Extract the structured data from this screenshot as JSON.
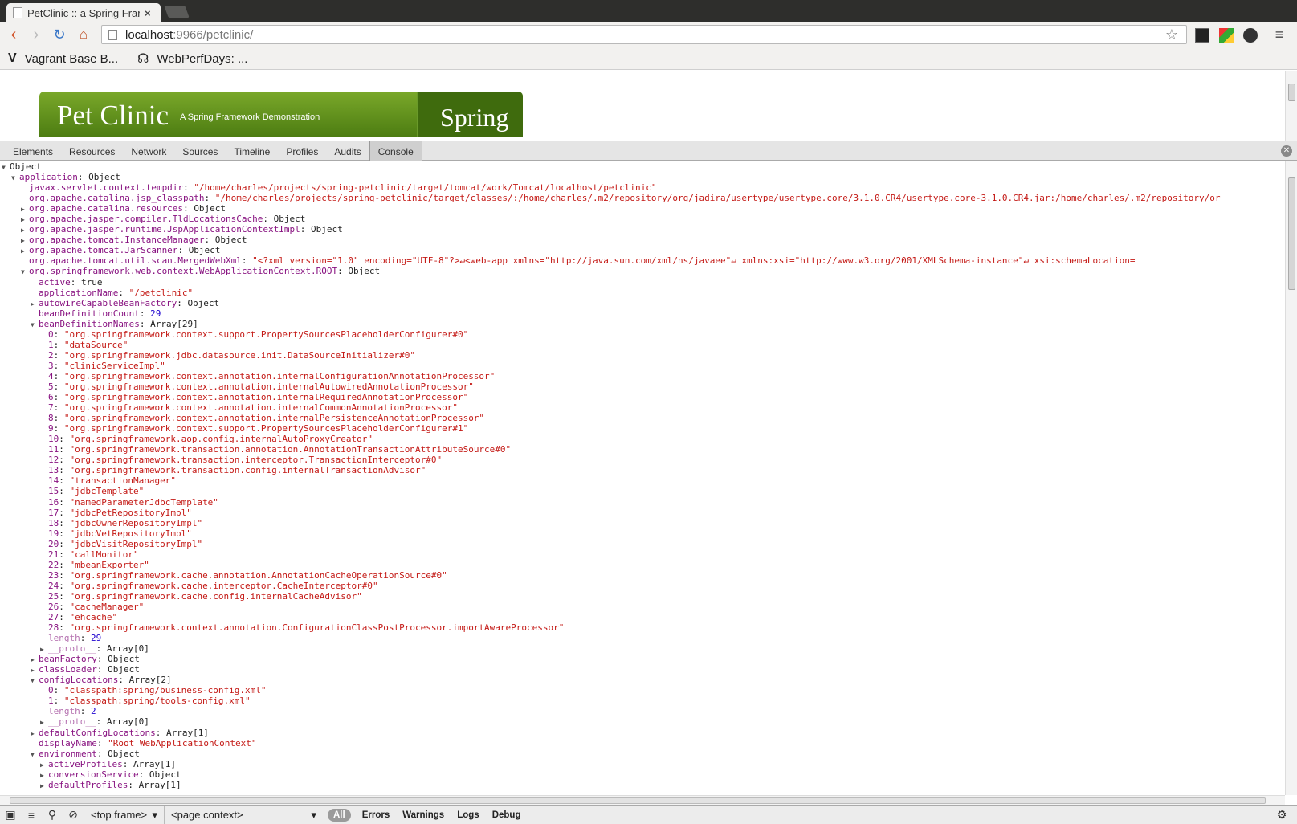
{
  "browser": {
    "tab_title": "PetClinic :: a Spring Frame",
    "tab_close": "×",
    "url_host": "localhost",
    "url_path": ":9966/petclinic/",
    "bookmarks": [
      {
        "icon": "V",
        "label": "Vagrant Base B..."
      },
      {
        "icon": "☊",
        "label": "WebPerfDays: ..."
      }
    ]
  },
  "page": {
    "banner_title": "Pet Clinic",
    "banner_subtitle": "A Spring Framework Demonstration",
    "banner_logo": "Spring"
  },
  "devtools": {
    "tabs": [
      "Elements",
      "Resources",
      "Network",
      "Sources",
      "Timeline",
      "Profiles",
      "Audits",
      "Console"
    ],
    "active_tab": "Console",
    "status": {
      "frame": "<top frame>",
      "context": "<page context>",
      "filters": [
        "All",
        "Errors",
        "Warnings",
        "Logs",
        "Debug"
      ]
    }
  },
  "console": {
    "lines": [
      {
        "indent": 0,
        "tri": "▼",
        "key": "Object",
        "keyclass": "v",
        "sep": "",
        "val": "",
        "valclass": "v"
      },
      {
        "indent": 1,
        "tri": "▼",
        "key": "application",
        "keyclass": "k",
        "sep": ": ",
        "val": "Object",
        "valclass": "v"
      },
      {
        "indent": 2,
        "tri": "",
        "key": "javax.servlet.context.tempdir",
        "keyclass": "k",
        "sep": ": ",
        "val": "\"/home/charles/projects/spring-petclinic/target/tomcat/work/Tomcat/localhost/petclinic\"",
        "valclass": "s"
      },
      {
        "indent": 2,
        "tri": "",
        "key": "org.apache.catalina.jsp_classpath",
        "keyclass": "k",
        "sep": ": ",
        "val": "\"/home/charles/projects/spring-petclinic/target/classes/:/home/charles/.m2/repository/org/jadira/usertype/usertype.core/3.1.0.CR4/usertype.core-3.1.0.CR4.jar:/home/charles/.m2/repository/or",
        "valclass": "s"
      },
      {
        "indent": 2,
        "tri": "▶",
        "key": "org.apache.catalina.resources",
        "keyclass": "k",
        "sep": ": ",
        "val": "Object",
        "valclass": "v"
      },
      {
        "indent": 2,
        "tri": "▶",
        "key": "org.apache.jasper.compiler.TldLocationsCache",
        "keyclass": "k",
        "sep": ": ",
        "val": "Object",
        "valclass": "v"
      },
      {
        "indent": 2,
        "tri": "▶",
        "key": "org.apache.jasper.runtime.JspApplicationContextImpl",
        "keyclass": "k",
        "sep": ": ",
        "val": "Object",
        "valclass": "v"
      },
      {
        "indent": 2,
        "tri": "▶",
        "key": "org.apache.tomcat.InstanceManager",
        "keyclass": "k",
        "sep": ": ",
        "val": "Object",
        "valclass": "v"
      },
      {
        "indent": 2,
        "tri": "▶",
        "key": "org.apache.tomcat.JarScanner",
        "keyclass": "k",
        "sep": ": ",
        "val": "Object",
        "valclass": "v"
      },
      {
        "indent": 2,
        "tri": "",
        "key": "org.apache.tomcat.util.scan.MergedWebXml",
        "keyclass": "k",
        "sep": ": ",
        "val": "\"<?xml version=\"1.0\" encoding=\"UTF-8\"?>↵<web-app xmlns=\"http://java.sun.com/xml/ns/javaee\"↵         xmlns:xsi=\"http://www.w3.org/2001/XMLSchema-instance\"↵         xsi:schemaLocation=",
        "valclass": "s"
      },
      {
        "indent": 2,
        "tri": "▼",
        "key": "org.springframework.web.context.WebApplicationContext.ROOT",
        "keyclass": "k",
        "sep": ": ",
        "val": "Object",
        "valclass": "v"
      },
      {
        "indent": 3,
        "tri": "",
        "key": "active",
        "keyclass": "k",
        "sep": ": ",
        "val": "true",
        "valclass": "v"
      },
      {
        "indent": 3,
        "tri": "",
        "key": "applicationName",
        "keyclass": "k",
        "sep": ": ",
        "val": "\"/petclinic\"",
        "valclass": "s"
      },
      {
        "indent": 3,
        "tri": "▶",
        "key": "autowireCapableBeanFactory",
        "keyclass": "k",
        "sep": ": ",
        "val": "Object",
        "valclass": "v"
      },
      {
        "indent": 3,
        "tri": "",
        "key": "beanDefinitionCount",
        "keyclass": "k",
        "sep": ": ",
        "val": "29",
        "valclass": "n"
      },
      {
        "indent": 3,
        "tri": "▼",
        "key": "beanDefinitionNames",
        "keyclass": "k",
        "sep": ": ",
        "val": "Array[29]",
        "valclass": "v"
      },
      {
        "indent": 4,
        "tri": "",
        "key": "0",
        "keyclass": "k",
        "sep": ": ",
        "val": "\"org.springframework.context.support.PropertySourcesPlaceholderConfigurer#0\"",
        "valclass": "s"
      },
      {
        "indent": 4,
        "tri": "",
        "key": "1",
        "keyclass": "k",
        "sep": ": ",
        "val": "\"dataSource\"",
        "valclass": "s"
      },
      {
        "indent": 4,
        "tri": "",
        "key": "2",
        "keyclass": "k",
        "sep": ": ",
        "val": "\"org.springframework.jdbc.datasource.init.DataSourceInitializer#0\"",
        "valclass": "s"
      },
      {
        "indent": 4,
        "tri": "",
        "key": "3",
        "keyclass": "k",
        "sep": ": ",
        "val": "\"clinicServiceImpl\"",
        "valclass": "s"
      },
      {
        "indent": 4,
        "tri": "",
        "key": "4",
        "keyclass": "k",
        "sep": ": ",
        "val": "\"org.springframework.context.annotation.internalConfigurationAnnotationProcessor\"",
        "valclass": "s"
      },
      {
        "indent": 4,
        "tri": "",
        "key": "5",
        "keyclass": "k",
        "sep": ": ",
        "val": "\"org.springframework.context.annotation.internalAutowiredAnnotationProcessor\"",
        "valclass": "s"
      },
      {
        "indent": 4,
        "tri": "",
        "key": "6",
        "keyclass": "k",
        "sep": ": ",
        "val": "\"org.springframework.context.annotation.internalRequiredAnnotationProcessor\"",
        "valclass": "s"
      },
      {
        "indent": 4,
        "tri": "",
        "key": "7",
        "keyclass": "k",
        "sep": ": ",
        "val": "\"org.springframework.context.annotation.internalCommonAnnotationProcessor\"",
        "valclass": "s"
      },
      {
        "indent": 4,
        "tri": "",
        "key": "8",
        "keyclass": "k",
        "sep": ": ",
        "val": "\"org.springframework.context.annotation.internalPersistenceAnnotationProcessor\"",
        "valclass": "s"
      },
      {
        "indent": 4,
        "tri": "",
        "key": "9",
        "keyclass": "k",
        "sep": ": ",
        "val": "\"org.springframework.context.support.PropertySourcesPlaceholderConfigurer#1\"",
        "valclass": "s"
      },
      {
        "indent": 4,
        "tri": "",
        "key": "10",
        "keyclass": "k",
        "sep": ": ",
        "val": "\"org.springframework.aop.config.internalAutoProxyCreator\"",
        "valclass": "s"
      },
      {
        "indent": 4,
        "tri": "",
        "key": "11",
        "keyclass": "k",
        "sep": ": ",
        "val": "\"org.springframework.transaction.annotation.AnnotationTransactionAttributeSource#0\"",
        "valclass": "s"
      },
      {
        "indent": 4,
        "tri": "",
        "key": "12",
        "keyclass": "k",
        "sep": ": ",
        "val": "\"org.springframework.transaction.interceptor.TransactionInterceptor#0\"",
        "valclass": "s"
      },
      {
        "indent": 4,
        "tri": "",
        "key": "13",
        "keyclass": "k",
        "sep": ": ",
        "val": "\"org.springframework.transaction.config.internalTransactionAdvisor\"",
        "valclass": "s"
      },
      {
        "indent": 4,
        "tri": "",
        "key": "14",
        "keyclass": "k",
        "sep": ": ",
        "val": "\"transactionManager\"",
        "valclass": "s"
      },
      {
        "indent": 4,
        "tri": "",
        "key": "15",
        "keyclass": "k",
        "sep": ": ",
        "val": "\"jdbcTemplate\"",
        "valclass": "s"
      },
      {
        "indent": 4,
        "tri": "",
        "key": "16",
        "keyclass": "k",
        "sep": ": ",
        "val": "\"namedParameterJdbcTemplate\"",
        "valclass": "s"
      },
      {
        "indent": 4,
        "tri": "",
        "key": "17",
        "keyclass": "k",
        "sep": ": ",
        "val": "\"jdbcPetRepositoryImpl\"",
        "valclass": "s"
      },
      {
        "indent": 4,
        "tri": "",
        "key": "18",
        "keyclass": "k",
        "sep": ": ",
        "val": "\"jdbcOwnerRepositoryImpl\"",
        "valclass": "s"
      },
      {
        "indent": 4,
        "tri": "",
        "key": "19",
        "keyclass": "k",
        "sep": ": ",
        "val": "\"jdbcVetRepositoryImpl\"",
        "valclass": "s"
      },
      {
        "indent": 4,
        "tri": "",
        "key": "20",
        "keyclass": "k",
        "sep": ": ",
        "val": "\"jdbcVisitRepositoryImpl\"",
        "valclass": "s"
      },
      {
        "indent": 4,
        "tri": "",
        "key": "21",
        "keyclass": "k",
        "sep": ": ",
        "val": "\"callMonitor\"",
        "valclass": "s"
      },
      {
        "indent": 4,
        "tri": "",
        "key": "22",
        "keyclass": "k",
        "sep": ": ",
        "val": "\"mbeanExporter\"",
        "valclass": "s"
      },
      {
        "indent": 4,
        "tri": "",
        "key": "23",
        "keyclass": "k",
        "sep": ": ",
        "val": "\"org.springframework.cache.annotation.AnnotationCacheOperationSource#0\"",
        "valclass": "s"
      },
      {
        "indent": 4,
        "tri": "",
        "key": "24",
        "keyclass": "k",
        "sep": ": ",
        "val": "\"org.springframework.cache.interceptor.CacheInterceptor#0\"",
        "valclass": "s"
      },
      {
        "indent": 4,
        "tri": "",
        "key": "25",
        "keyclass": "k",
        "sep": ": ",
        "val": "\"org.springframework.cache.config.internalCacheAdvisor\"",
        "valclass": "s"
      },
      {
        "indent": 4,
        "tri": "",
        "key": "26",
        "keyclass": "k",
        "sep": ": ",
        "val": "\"cacheManager\"",
        "valclass": "s"
      },
      {
        "indent": 4,
        "tri": "",
        "key": "27",
        "keyclass": "k",
        "sep": ": ",
        "val": "\"ehcache\"",
        "valclass": "s"
      },
      {
        "indent": 4,
        "tri": "",
        "key": "28",
        "keyclass": "k",
        "sep": ": ",
        "val": "\"org.springframework.context.annotation.ConfigurationClassPostProcessor.importAwareProcessor\"",
        "valclass": "s"
      },
      {
        "indent": 4,
        "tri": "",
        "key": "length",
        "keyclass": "k dim",
        "sep": ": ",
        "val": "29",
        "valclass": "n"
      },
      {
        "indent": 4,
        "tri": "▶",
        "key": "__proto__",
        "keyclass": "k dim",
        "sep": ": ",
        "val": "Array[0]",
        "valclass": "v"
      },
      {
        "indent": 3,
        "tri": "▶",
        "key": "beanFactory",
        "keyclass": "k",
        "sep": ": ",
        "val": "Object",
        "valclass": "v"
      },
      {
        "indent": 3,
        "tri": "▶",
        "key": "classLoader",
        "keyclass": "k",
        "sep": ": ",
        "val": "Object",
        "valclass": "v"
      },
      {
        "indent": 3,
        "tri": "▼",
        "key": "configLocations",
        "keyclass": "k",
        "sep": ": ",
        "val": "Array[2]",
        "valclass": "v"
      },
      {
        "indent": 4,
        "tri": "",
        "key": "0",
        "keyclass": "k",
        "sep": ": ",
        "val": "\"classpath:spring/business-config.xml\"",
        "valclass": "s"
      },
      {
        "indent": 4,
        "tri": "",
        "key": "1",
        "keyclass": "k",
        "sep": ": ",
        "val": "\"classpath:spring/tools-config.xml\"",
        "valclass": "s"
      },
      {
        "indent": 4,
        "tri": "",
        "key": "length",
        "keyclass": "k dim",
        "sep": ": ",
        "val": "2",
        "valclass": "n"
      },
      {
        "indent": 4,
        "tri": "▶",
        "key": "__proto__",
        "keyclass": "k dim",
        "sep": ": ",
        "val": "Array[0]",
        "valclass": "v"
      },
      {
        "indent": 3,
        "tri": "▶",
        "key": "defaultConfigLocations",
        "keyclass": "k",
        "sep": ": ",
        "val": "Array[1]",
        "valclass": "v"
      },
      {
        "indent": 3,
        "tri": "",
        "key": "displayName",
        "keyclass": "k",
        "sep": ": ",
        "val": "\"Root WebApplicationContext\"",
        "valclass": "s"
      },
      {
        "indent": 3,
        "tri": "▼",
        "key": "environment",
        "keyclass": "k",
        "sep": ": ",
        "val": "Object",
        "valclass": "v"
      },
      {
        "indent": 4,
        "tri": "▶",
        "key": "activeProfiles",
        "keyclass": "k",
        "sep": ": ",
        "val": "Array[1]",
        "valclass": "v"
      },
      {
        "indent": 4,
        "tri": "▶",
        "key": "conversionService",
        "keyclass": "k",
        "sep": ": ",
        "val": "Object",
        "valclass": "v"
      },
      {
        "indent": 4,
        "tri": "▶",
        "key": "defaultProfiles",
        "keyclass": "k",
        "sep": ": ",
        "val": "Array[1]",
        "valclass": "v"
      }
    ]
  }
}
